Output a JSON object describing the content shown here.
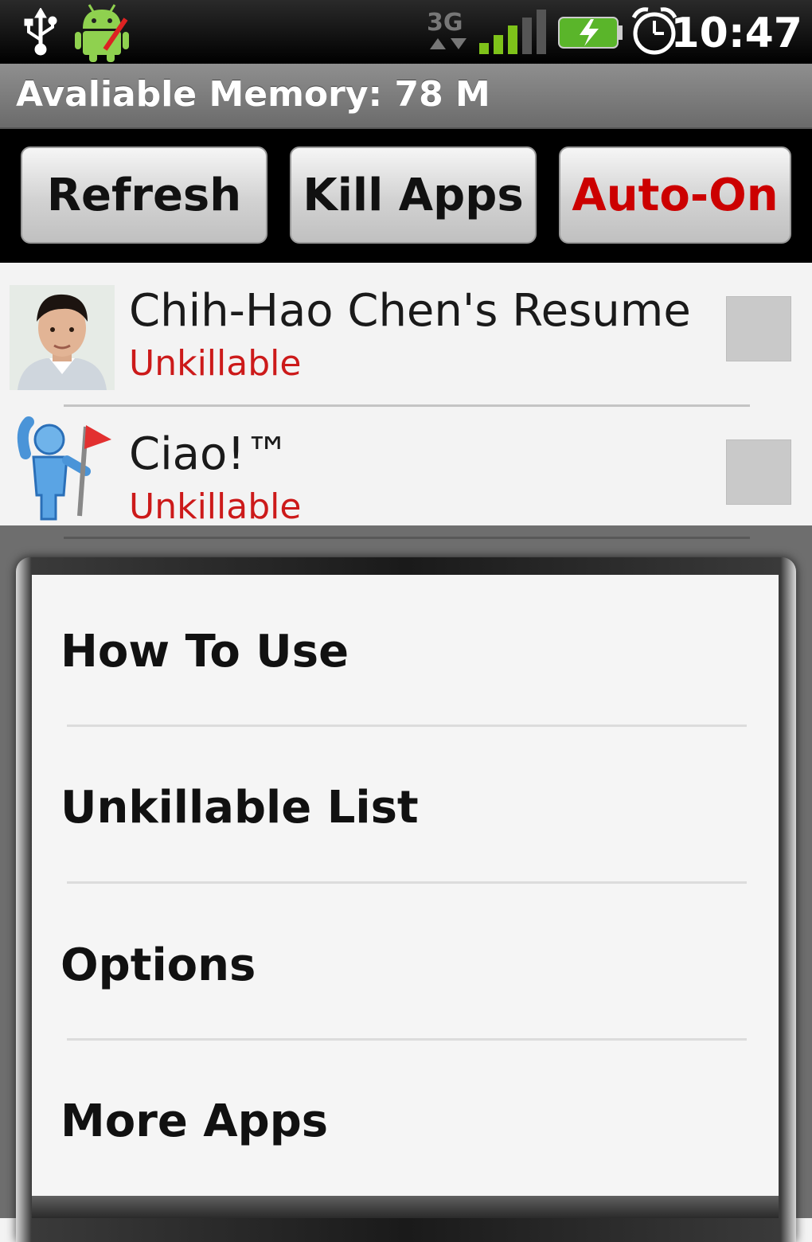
{
  "status_bar": {
    "network": "3G",
    "time": "10:47",
    "icons": [
      "usb-icon",
      "android-notification-icon",
      "3g-network-icon",
      "signal-strength-icon",
      "battery-charging-icon",
      "alarm-clock-icon"
    ]
  },
  "memory_bar": {
    "text": "Avaliable Memory: 78 M"
  },
  "buttons": {
    "refresh": "Refresh",
    "kill_apps": "Kill Apps",
    "auto_on": "Auto-On"
  },
  "apps": [
    {
      "name": "Chih-Hao Chen's Resume",
      "status": "Unkillable",
      "checked": false
    },
    {
      "name": "Ciao!™",
      "status": "Unkillable",
      "checked": false
    }
  ],
  "menu": {
    "items": [
      "How To Use",
      "Unkillable List",
      "Options",
      "More Apps"
    ]
  },
  "colors": {
    "accent_red": "#cc0000",
    "status_text": "#cc1a1a"
  }
}
